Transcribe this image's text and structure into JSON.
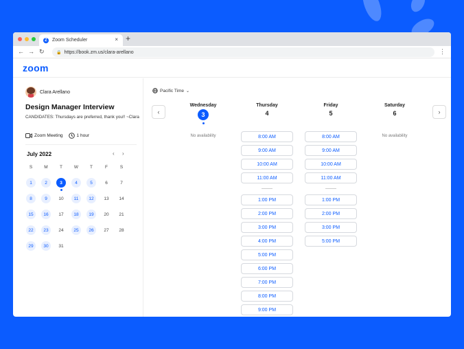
{
  "browser": {
    "tab_title": "Zoom Scheduler",
    "tab_favicon": "Z",
    "close_glyph": "×",
    "new_tab_glyph": "+",
    "url": "https://book.zm.us/clara-arellano",
    "back_glyph": "←",
    "forward_glyph": "→",
    "reload_glyph": "↻",
    "menu_glyph": "⋮",
    "traffic_lights": [
      "#fe5f57",
      "#febc2e",
      "#28c840"
    ]
  },
  "brand": {
    "logo": "zoom",
    "accent": "#0b5cff"
  },
  "host": {
    "name": "Clara Arellano"
  },
  "event": {
    "title": "Design Manager Interview",
    "description": "CANDIDATES: Thursdays are preferred, thank you!! ~Clara",
    "platform": "Zoom Meeting",
    "duration": "1 hour",
    "platform_icon": "video-icon",
    "duration_icon": "clock-icon"
  },
  "calendar": {
    "month_label": "July 2022",
    "prev_glyph": "‹",
    "next_glyph": "›",
    "weekdays": [
      "S",
      "M",
      "T",
      "W",
      "T",
      "F",
      "S"
    ],
    "weeks": [
      [
        {
          "d": "1",
          "s": "avail"
        },
        {
          "d": "2",
          "s": "avail"
        },
        {
          "d": "3",
          "s": "sel"
        },
        {
          "d": "4",
          "s": "avail"
        },
        {
          "d": "5",
          "s": "avail"
        },
        {
          "d": "6",
          "s": "none"
        },
        {
          "d": "7",
          "s": "none"
        }
      ],
      [
        {
          "d": "8",
          "s": "avail"
        },
        {
          "d": "9",
          "s": "avail"
        },
        {
          "d": "10",
          "s": "none"
        },
        {
          "d": "11",
          "s": "avail"
        },
        {
          "d": "12",
          "s": "avail"
        },
        {
          "d": "13",
          "s": "none"
        },
        {
          "d": "14",
          "s": "none"
        }
      ],
      [
        {
          "d": "15",
          "s": "avail"
        },
        {
          "d": "16",
          "s": "avail"
        },
        {
          "d": "17",
          "s": "none"
        },
        {
          "d": "18",
          "s": "avail"
        },
        {
          "d": "19",
          "s": "avail"
        },
        {
          "d": "20",
          "s": "none"
        },
        {
          "d": "21",
          "s": "none"
        }
      ],
      [
        {
          "d": "22",
          "s": "avail"
        },
        {
          "d": "23",
          "s": "avail"
        },
        {
          "d": "24",
          "s": "none"
        },
        {
          "d": "25",
          "s": "avail"
        },
        {
          "d": "26",
          "s": "avail"
        },
        {
          "d": "27",
          "s": "none"
        },
        {
          "d": "28",
          "s": "none"
        }
      ],
      [
        {
          "d": "29",
          "s": "avail"
        },
        {
          "d": "30",
          "s": "avail"
        },
        {
          "d": "31",
          "s": "none"
        }
      ]
    ]
  },
  "schedule": {
    "timezone": "Pacific Time",
    "timezone_icon": "globe-icon",
    "prev_glyph": "‹",
    "next_glyph": "›",
    "no_availability": "No availability",
    "days": [
      {
        "name": "Wednesday",
        "date": "3",
        "selected": true,
        "am": [],
        "pm": []
      },
      {
        "name": "Thursday",
        "date": "4",
        "selected": false,
        "am": [
          "8:00 AM",
          "9:00 AM",
          "10:00 AM",
          "11:00 AM"
        ],
        "pm": [
          "1:00 PM",
          "2:00 PM",
          "3:00 PM",
          "4:00 PM",
          "5:00 PM",
          "6:00 PM",
          "7:00 PM",
          "8:00 PM",
          "9:00 PM"
        ]
      },
      {
        "name": "Friday",
        "date": "5",
        "selected": false,
        "am": [
          "8:00 AM",
          "9:00 AM",
          "10:00 AM",
          "11:00 AM"
        ],
        "pm": [
          "1:00 PM",
          "2:00 PM",
          "3:00 PM",
          "5:00 PM"
        ]
      },
      {
        "name": "Saturday",
        "date": "6",
        "selected": false,
        "am": [],
        "pm": []
      }
    ]
  }
}
